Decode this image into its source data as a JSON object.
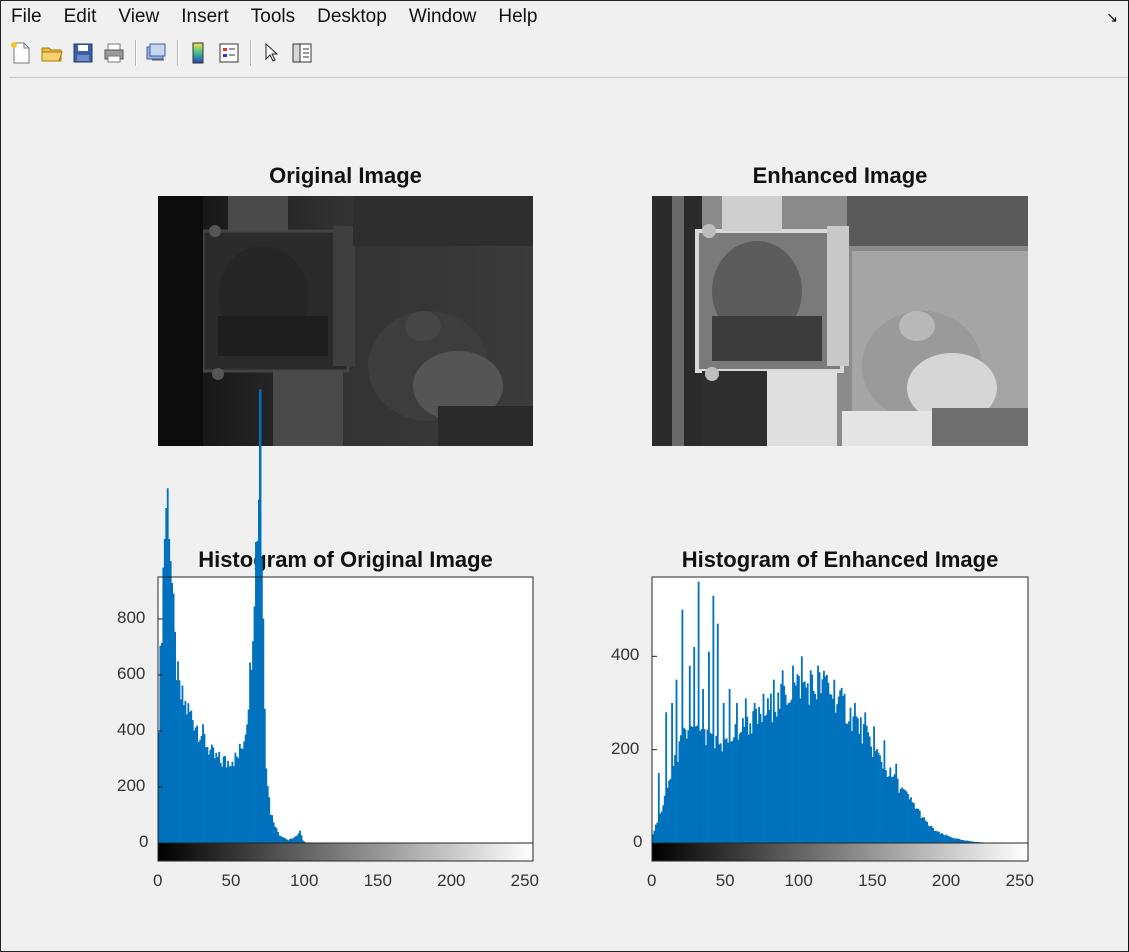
{
  "menu": [
    "File",
    "Edit",
    "View",
    "Insert",
    "Tools",
    "Desktop",
    "Window",
    "Help"
  ],
  "corner_icon": "dock-arrow-icon",
  "toolbar": [
    {
      "name": "new-figure-icon"
    },
    {
      "name": "open-file-icon"
    },
    {
      "name": "save-figure-icon"
    },
    {
      "name": "print-figure-icon"
    },
    {
      "sep": true
    },
    {
      "name": "link-plot-icon"
    },
    {
      "sep": true
    },
    {
      "name": "insert-colorbar-icon"
    },
    {
      "name": "insert-legend-icon"
    },
    {
      "sep": true
    },
    {
      "name": "edit-plot-arrow-icon"
    },
    {
      "name": "property-inspector-icon"
    }
  ],
  "images": {
    "original_title": "Original Image",
    "enhanced_title": "Enhanced Image"
  },
  "colors": {
    "bar": "#0072bd",
    "background": "#f0f0f0"
  },
  "chart_data": [
    {
      "type": "bar",
      "title": "Histogram of Original Image",
      "xlabel": "",
      "ylabel": "",
      "xlim": [
        0,
        255
      ],
      "ylim": [
        0,
        950
      ],
      "yticks": [
        0,
        200,
        400,
        800,
        600
      ],
      "xticks": [
        0,
        50,
        100,
        150,
        200,
        250
      ],
      "y_tick_labels": [
        "0",
        "200",
        "400",
        "600",
        "800"
      ],
      "x_tick_labels": [
        "0",
        "50",
        "100",
        "150",
        "200",
        "250"
      ],
      "control_points": [
        [
          0,
          450
        ],
        [
          1,
          640
        ],
        [
          2,
          800
        ],
        [
          3,
          970
        ],
        [
          4,
          1120
        ],
        [
          5,
          1210
        ],
        [
          6,
          1230
        ],
        [
          7,
          1180
        ],
        [
          8,
          1050
        ],
        [
          9,
          920
        ],
        [
          10,
          800
        ],
        [
          11,
          700
        ],
        [
          12,
          630
        ],
        [
          13,
          580
        ],
        [
          14,
          540
        ],
        [
          15,
          520
        ],
        [
          16,
          510
        ],
        [
          17,
          500
        ],
        [
          18,
          490
        ],
        [
          19,
          480
        ],
        [
          20,
          470
        ],
        [
          22,
          455
        ],
        [
          24,
          440
        ],
        [
          26,
          420
        ],
        [
          28,
          400
        ],
        [
          30,
          380
        ],
        [
          32,
          360
        ],
        [
          34,
          340
        ],
        [
          36,
          315
        ],
        [
          38,
          305
        ],
        [
          40,
          300
        ],
        [
          42,
          290
        ],
        [
          44,
          295
        ],
        [
          46,
          285
        ],
        [
          48,
          300
        ],
        [
          50,
          305
        ],
        [
          52,
          300
        ],
        [
          54,
          310
        ],
        [
          56,
          340
        ],
        [
          58,
          380
        ],
        [
          60,
          460
        ],
        [
          62,
          600
        ],
        [
          64,
          800
        ],
        [
          65,
          940
        ],
        [
          66,
          1050
        ],
        [
          67,
          1150
        ],
        [
          68,
          1260
        ],
        [
          69,
          1230
        ],
        [
          70,
          1050
        ],
        [
          71,
          800
        ],
        [
          72,
          520
        ],
        [
          73,
          300
        ],
        [
          74,
          220
        ],
        [
          75,
          160
        ],
        [
          76,
          110
        ],
        [
          78,
          80
        ],
        [
          80,
          50
        ],
        [
          82,
          30
        ],
        [
          85,
          20
        ],
        [
          88,
          10
        ],
        [
          90,
          15
        ],
        [
          92,
          20
        ],
        [
          94,
          25
        ],
        [
          96,
          40
        ],
        [
          97,
          30
        ],
        [
          98,
          10
        ],
        [
          100,
          0
        ],
        [
          255,
          0
        ]
      ],
      "spike": {
        "x": 69,
        "y": 1620
      }
    },
    {
      "type": "bar",
      "title": "Histogram of Enhanced Image",
      "xlabel": "",
      "ylabel": "",
      "xlim": [
        0,
        255
      ],
      "ylim": [
        0,
        570
      ],
      "yticks": [
        0,
        200,
        400
      ],
      "xticks": [
        0,
        50,
        100,
        150,
        200,
        250
      ],
      "y_tick_labels": [
        "0",
        "200",
        "400"
      ],
      "x_tick_labels": [
        "0",
        "50",
        "100",
        "150",
        "200",
        "250"
      ],
      "control_points": [
        [
          0,
          20
        ],
        [
          5,
          60
        ],
        [
          10,
          120
        ],
        [
          15,
          170
        ],
        [
          20,
          220
        ],
        [
          25,
          240
        ],
        [
          30,
          230
        ],
        [
          35,
          220
        ],
        [
          40,
          215
        ],
        [
          45,
          210
        ],
        [
          50,
          215
        ],
        [
          55,
          230
        ],
        [
          60,
          245
        ],
        [
          65,
          255
        ],
        [
          70,
          260
        ],
        [
          75,
          275
        ],
        [
          80,
          290
        ],
        [
          85,
          300
        ],
        [
          90,
          315
        ],
        [
          95,
          330
        ],
        [
          100,
          340
        ],
        [
          105,
          335
        ],
        [
          110,
          330
        ],
        [
          115,
          340
        ],
        [
          120,
          330
        ],
        [
          125,
          310
        ],
        [
          130,
          290
        ],
        [
          135,
          270
        ],
        [
          140,
          250
        ],
        [
          145,
          225
        ],
        [
          150,
          200
        ],
        [
          155,
          175
        ],
        [
          160,
          150
        ],
        [
          165,
          130
        ],
        [
          170,
          110
        ],
        [
          175,
          90
        ],
        [
          180,
          70
        ],
        [
          185,
          45
        ],
        [
          190,
          30
        ],
        [
          195,
          20
        ],
        [
          200,
          15
        ],
        [
          205,
          10
        ],
        [
          210,
          6
        ],
        [
          215,
          4
        ],
        [
          220,
          2
        ],
        [
          225,
          1
        ],
        [
          230,
          0
        ],
        [
          255,
          0
        ]
      ],
      "spikes": [
        [
          4,
          150
        ],
        [
          9,
          280
        ],
        [
          13,
          300
        ],
        [
          16,
          350
        ],
        [
          20,
          500
        ],
        [
          25,
          380
        ],
        [
          28,
          420
        ],
        [
          31,
          560
        ],
        [
          34,
          330
        ],
        [
          38,
          410
        ],
        [
          41,
          530
        ],
        [
          44,
          470
        ],
        [
          48,
          300
        ],
        [
          52,
          330
        ],
        [
          57,
          300
        ],
        [
          63,
          310
        ],
        [
          69,
          300
        ],
        [
          75,
          320
        ],
        [
          82,
          350
        ],
        [
          88,
          370
        ],
        [
          95,
          380
        ],
        [
          101,
          400
        ],
        [
          107,
          370
        ],
        [
          112,
          380
        ],
        [
          118,
          360
        ],
        [
          123,
          350
        ],
        [
          130,
          320
        ],
        [
          137,
          300
        ],
        [
          144,
          280
        ],
        [
          150,
          250
        ],
        [
          157,
          220
        ],
        [
          165,
          170
        ]
      ]
    }
  ]
}
